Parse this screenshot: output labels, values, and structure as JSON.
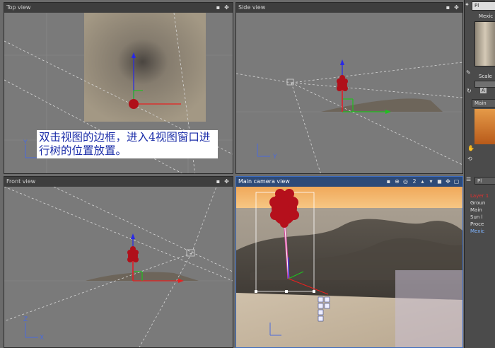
{
  "viewports": {
    "top": {
      "title": "Top view"
    },
    "side": {
      "title": "Side view"
    },
    "front": {
      "title": "Front view"
    },
    "camera": {
      "title": "Main camera view",
      "counter": "2"
    }
  },
  "caption": "双击视图的边框，进入4视图窗口进行树的位置放置。",
  "axes": {
    "x": "X",
    "y": "Y",
    "z": "Z"
  },
  "panel": {
    "tab_top": "Pl",
    "label_mex": "Mexic",
    "label_scale": "Scale",
    "ac_letter": "A",
    "label_main": "Main",
    "tab_pl2": "Pl",
    "layers": [
      {
        "label": "Layer 1",
        "style": "red"
      },
      {
        "label": "Groun",
        "style": ""
      },
      {
        "label": "Main",
        "style": ""
      },
      {
        "label": "Sun l",
        "style": ""
      },
      {
        "label": "Proce",
        "style": ""
      },
      {
        "label": "Mexic",
        "style": "sel"
      }
    ]
  },
  "colors": {
    "viewport_bg": "#7a7a7a",
    "titlebar": "#3e3e3e",
    "active_titlebar": "#2d4a78",
    "sky": "#f2b25e",
    "ground_plane": "#c9b9a4",
    "tree": "#c0121c",
    "axis_x": "#e02020",
    "axis_y": "#20c020",
    "axis_z": "#2020e0"
  }
}
